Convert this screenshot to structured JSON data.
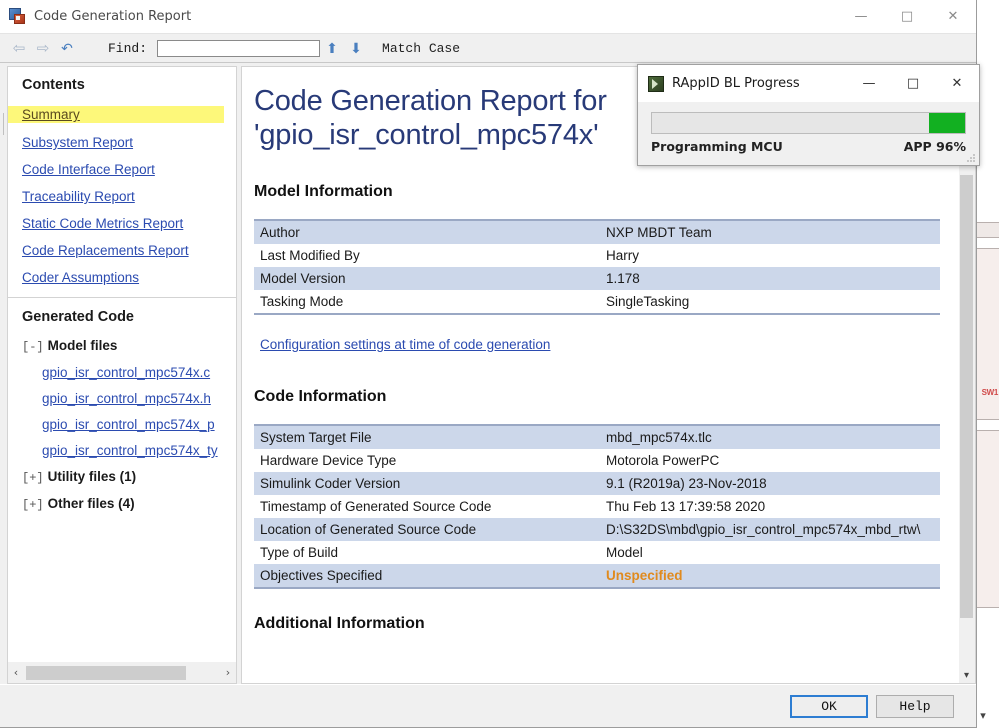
{
  "window": {
    "title": "Code Generation Report",
    "icon": "simulink-report-icon",
    "controls": {
      "minimize": "—",
      "maximize": "□",
      "close": "✕"
    }
  },
  "toolbar": {
    "back_icon": "back-arrow-icon",
    "forward_icon": "forward-arrow-icon",
    "refresh_icon": "refresh-icon",
    "find_label": "Find:",
    "find_value": "",
    "find_placeholder": "",
    "find_prev_icon": "arrow-up-icon",
    "find_next_icon": "arrow-down-icon",
    "match_case_label": "Match Case"
  },
  "sidebar": {
    "contents_heading": "Contents",
    "toc": [
      {
        "label": "Summary",
        "active": true
      },
      {
        "label": "Subsystem Report",
        "active": false
      },
      {
        "label": "Code Interface Report",
        "active": false
      },
      {
        "label": "Traceability Report",
        "active": false
      },
      {
        "label": "Static Code Metrics Report",
        "active": false
      },
      {
        "label": "Code Replacements Report",
        "active": false
      },
      {
        "label": "Coder Assumptions",
        "active": false
      }
    ],
    "generated_code_heading": "Generated Code",
    "groups": [
      {
        "toggle": "[-]",
        "label": "Model files"
      },
      {
        "toggle": "[+]",
        "label": "Utility files (1)"
      },
      {
        "toggle": "[+]",
        "label": "Other files (4)"
      }
    ],
    "model_files": [
      "gpio_isr_control_mpc574x.c",
      "gpio_isr_control_mpc574x.h",
      "gpio_isr_control_mpc574x_p",
      "gpio_isr_control_mpc574x_ty"
    ],
    "hscroll": {
      "left_icon": "chevron-left-icon",
      "right_icon": "chevron-right-icon"
    }
  },
  "content": {
    "doc_title": "Code Generation Report for 'gpio_isr_control_mpc574x'",
    "model_info_heading": "Model Information",
    "model_info_rows": [
      {
        "key": "Author",
        "value": "NXP MBDT Team"
      },
      {
        "key": "Last Modified By",
        "value": "Harry"
      },
      {
        "key": "Model Version",
        "value": "1.178"
      },
      {
        "key": "Tasking Mode",
        "value": "SingleTasking"
      }
    ],
    "config_link": "Configuration settings at time of code generation",
    "code_info_heading": "Code Information",
    "code_info_rows": [
      {
        "key": "System Target File",
        "value": "mbd_mpc574x.tlc",
        "warn": false
      },
      {
        "key": "Hardware Device Type",
        "value": "Motorola PowerPC",
        "warn": false
      },
      {
        "key": "Simulink Coder Version",
        "value": "9.1 (R2019a) 23-Nov-2018",
        "warn": false
      },
      {
        "key": "Timestamp of Generated Source Code",
        "value": "Thu Feb 13 17:39:58 2020",
        "warn": false
      },
      {
        "key": "Location of Generated Source Code",
        "value": "D:\\S32DS\\mbd\\gpio_isr_control_mpc574x_mbd_rtw\\",
        "warn": false
      },
      {
        "key": "Type of Build",
        "value": "Model",
        "warn": false
      },
      {
        "key": "Objectives Specified",
        "value": "Unspecified",
        "warn": true
      }
    ],
    "additional_heading": "Additional Information",
    "scrollbar_down_icon": "chevron-down-icon"
  },
  "footer": {
    "ok_label": "OK",
    "help_label": "Help"
  },
  "progress_dialog": {
    "icon": "rappid-app-icon",
    "title": "RAppID BL Progress",
    "minimize": "—",
    "maximize": "□",
    "close": "✕",
    "status_text": "Programming MCU",
    "percent_text": "APP 96%",
    "percent_value": 96,
    "bar_color": "#12b021"
  },
  "background_window": {
    "label": "SW1"
  },
  "colors": {
    "title_blue": "#283a78",
    "link_blue": "#2b4bb0",
    "row_alt": "#ccd7ea",
    "highlight_yellow": "#fdf87a",
    "warn_orange": "#e08a1e",
    "progress_green": "#12b021",
    "focus_blue": "#2d7dd2"
  }
}
